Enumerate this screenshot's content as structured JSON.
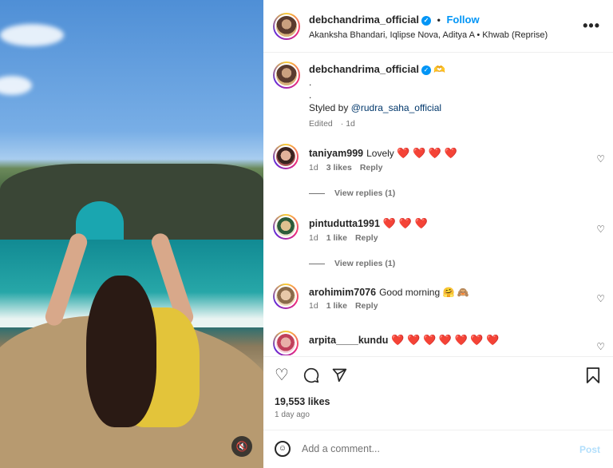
{
  "header": {
    "username": "debchandrima_official",
    "verified_icon": "verified-badge-icon",
    "follow_label": "Follow",
    "separator": "•",
    "audio": "Akanksha Bhandari, Iqlipse Nova, Aditya A • Khwab (Reprise)",
    "more_icon": "more-options-icon",
    "more_label": "•••"
  },
  "caption": {
    "username": "debchandrima_official",
    "emoji": "🫶",
    "line1": ".",
    "line2": ".",
    "styled_prefix": "Styled by ",
    "mention": "@rudra_saha_official",
    "edited": "Edited",
    "time": "1d"
  },
  "comments": [
    {
      "username": "taniyam999",
      "text": "Lovely",
      "emoji": "❤️ ❤️ ❤️ ❤️",
      "time": "1d",
      "likes": "3 likes",
      "reply": "Reply",
      "view_replies": "View replies (1)"
    },
    {
      "username": "pintudutta1991",
      "text": "",
      "emoji": "❤️ ❤️ ❤️",
      "time": "1d",
      "likes": "1 like",
      "reply": "Reply",
      "view_replies": "View replies (1)"
    },
    {
      "username": "arohimim7076",
      "text": "Good morning",
      "emoji": "🤗 🙈",
      "time": "1d",
      "likes": "1 like",
      "reply": "Reply",
      "view_replies": ""
    },
    {
      "username": "arpita____kundu",
      "text": "",
      "emoji": "❤️ ❤️ ❤️ ❤️ ❤️ ❤️ ❤️",
      "time": "",
      "likes": "",
      "reply": "",
      "view_replies": ""
    }
  ],
  "actions": {
    "like_icon": "heart-icon",
    "comment_icon": "comment-icon",
    "share_icon": "share-icon",
    "save_icon": "bookmark-icon"
  },
  "likes_count": "19,553 likes",
  "posted_ago": "1 day ago",
  "add_comment": {
    "placeholder": "Add a comment...",
    "post_label": "Post",
    "emoji_icon": "emoji-icon"
  },
  "media": {
    "mute_icon": "mute-icon"
  }
}
